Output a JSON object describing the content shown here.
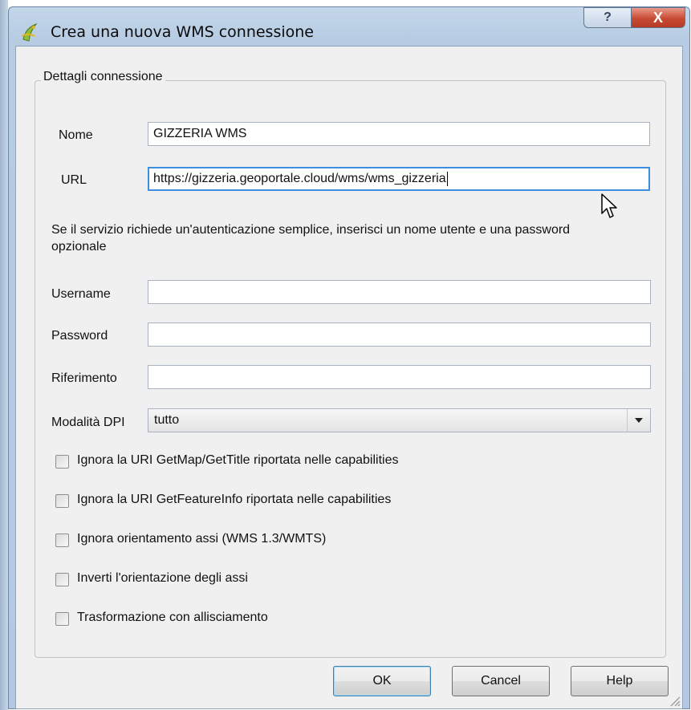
{
  "window": {
    "title": "Crea una nuova WMS connessione",
    "help_symbol": "?",
    "close_symbol": "X"
  },
  "group": {
    "legend": "Dettagli connessione"
  },
  "fields": {
    "nome": {
      "label": "Nome",
      "value": "GIZZERIA WMS"
    },
    "url": {
      "label": "URL",
      "value": "https://gizzeria.geoportale.cloud/wms/wms_gizzeria"
    },
    "info_text": "Se il servizio richiede un'autenticazione semplice, inserisci un nome utente e una password opzionale",
    "username": {
      "label": "Username",
      "value": ""
    },
    "password": {
      "label": "Password",
      "value": ""
    },
    "riferimento": {
      "label": "Riferimento",
      "value": ""
    },
    "dpi": {
      "label": "Modalità DPI",
      "value": "tutto"
    }
  },
  "checkboxes": [
    {
      "label": "Ignora la URI GetMap/GetTitle riportata nelle capabilities",
      "checked": false
    },
    {
      "label": "Ignora la URI GetFeatureInfo riportata nelle capabilities",
      "checked": false
    },
    {
      "label": "Ignora orientamento assi (WMS 1.3/WMTS)",
      "checked": false
    },
    {
      "label": "Inverti l'orientazione degli assi",
      "checked": false
    },
    {
      "label": "Trasformazione con allisciamento",
      "checked": false
    }
  ],
  "buttons": {
    "ok": "OK",
    "cancel": "Cancel",
    "help": "Help"
  },
  "icons": {
    "app": "qgis-icon",
    "cursor": "mouse-pointer-icon"
  },
  "colors": {
    "focus_border": "#3c8ee0",
    "close_button": "#c74a33",
    "window_frame": "#b7cce3"
  }
}
